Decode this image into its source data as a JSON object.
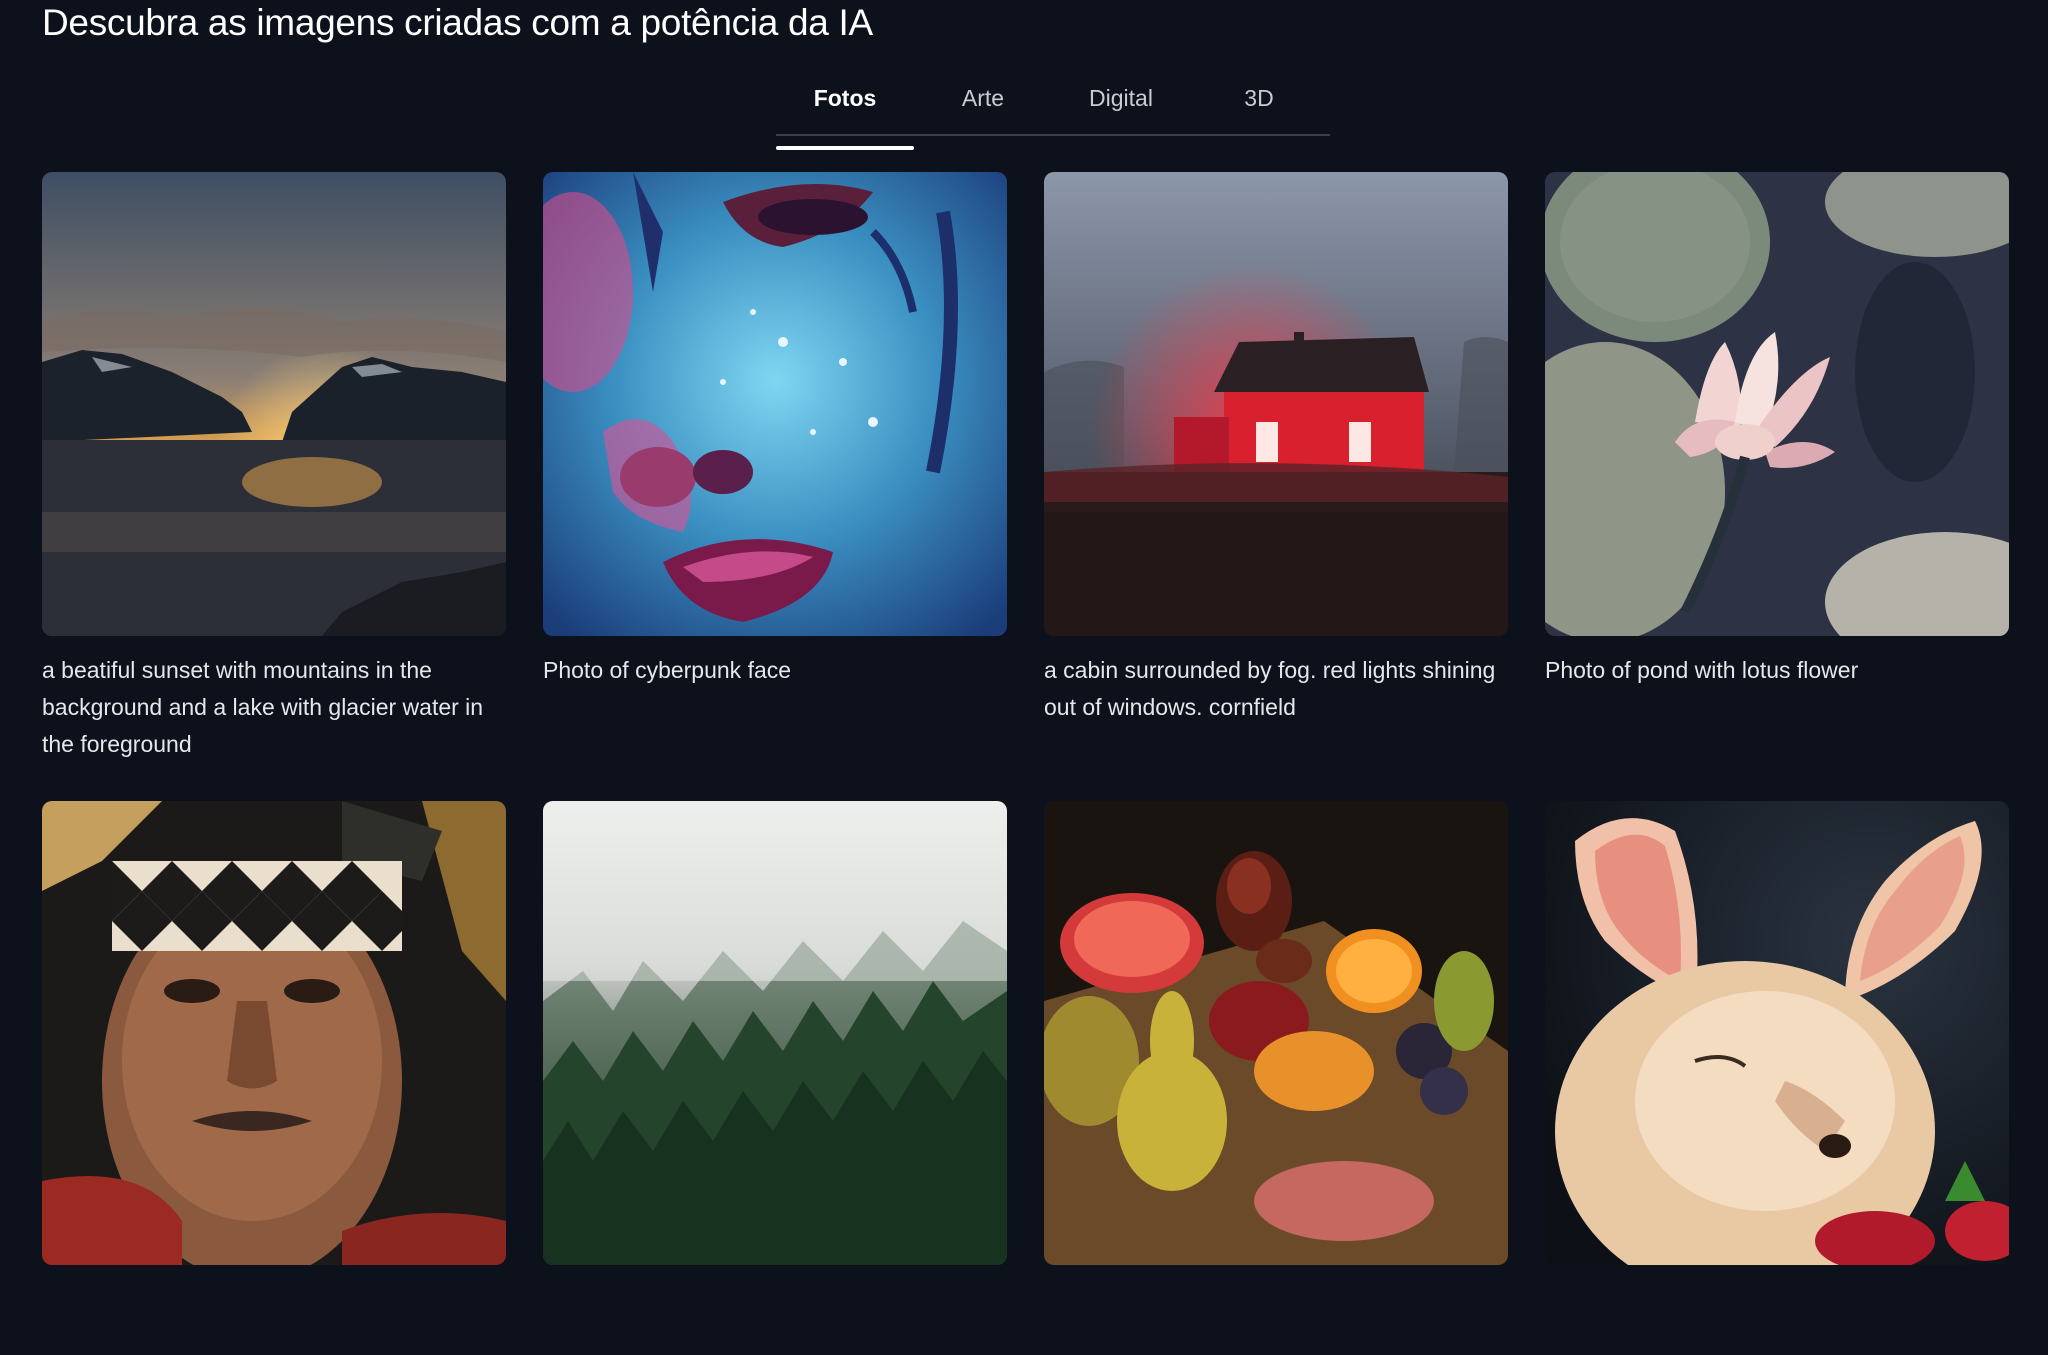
{
  "header": {
    "title": "Descubra as imagens criadas com a potência da IA"
  },
  "tabs": [
    {
      "label": "Fotos",
      "active": true
    },
    {
      "label": "Arte",
      "active": false
    },
    {
      "label": "Digital",
      "active": false
    },
    {
      "label": "3D",
      "active": false
    }
  ],
  "gallery": {
    "items": [
      {
        "caption": "a beatiful sunset with mountains in the background and a lake with glacier water in the foreground",
        "icon": "sunset-mountain-lake-image"
      },
      {
        "caption": "Photo of cyberpunk face",
        "icon": "cyberpunk-face-image"
      },
      {
        "caption": "a cabin surrounded by fog. red lights shining out of windows. cornfield",
        "icon": "foggy-red-cabin-image"
      },
      {
        "caption": "Photo of pond with lotus flower",
        "icon": "lotus-pond-image"
      },
      {
        "caption": "",
        "icon": "tribal-portrait-image"
      },
      {
        "caption": "",
        "icon": "foggy-forest-image"
      },
      {
        "caption": "",
        "icon": "fruit-still-life-image"
      },
      {
        "caption": "",
        "icon": "fennec-fox-image"
      }
    ]
  },
  "colors": {
    "background": "#0c111b",
    "text": "#ffffff",
    "tab_inactive": "#c9ccd2",
    "tab_border": "#3a3f4a"
  }
}
